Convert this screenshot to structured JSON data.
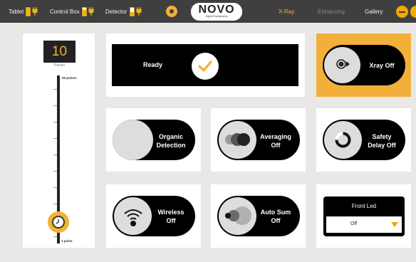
{
  "topbar": {
    "tablet_label": "Tablet",
    "control_box_label": "Control Box",
    "detector_label": "Detector",
    "logo_title": "NOVO",
    "logo_subtitle": "Digital Radiography",
    "tabs": [
      {
        "label": "X-Ray",
        "state": "active"
      },
      {
        "label": "Enhancing",
        "state": "disabled"
      },
      {
        "label": "Gallery",
        "state": "normal"
      }
    ],
    "icons": [
      "battery-icon",
      "plug-icon",
      "disc-icon",
      "minimize-icon"
    ]
  },
  "pulses": {
    "value": "10",
    "label": "Pulses",
    "max_label": "99 pulses",
    "min_label": "1 pulse"
  },
  "ready": {
    "label": "Ready"
  },
  "xray": {
    "label": "Xray Off"
  },
  "organic": {
    "label_line1": "Organic",
    "label_line2": "Detection"
  },
  "averaging": {
    "label_line1": "Averaging",
    "label_line2": "Off"
  },
  "safety": {
    "label_line1": "Safety",
    "label_line2": "Delay Off"
  },
  "wireless": {
    "label_line1": "Wireless",
    "label_line2": "Off"
  },
  "autosum": {
    "label_line1": "Auto Sum",
    "label_line2": "Off"
  },
  "front_led": {
    "title": "Front Led",
    "value": "Off"
  },
  "colors": {
    "accent": "#f2b233",
    "topbar": "#3f3f3f",
    "background": "#e9e8e6"
  }
}
